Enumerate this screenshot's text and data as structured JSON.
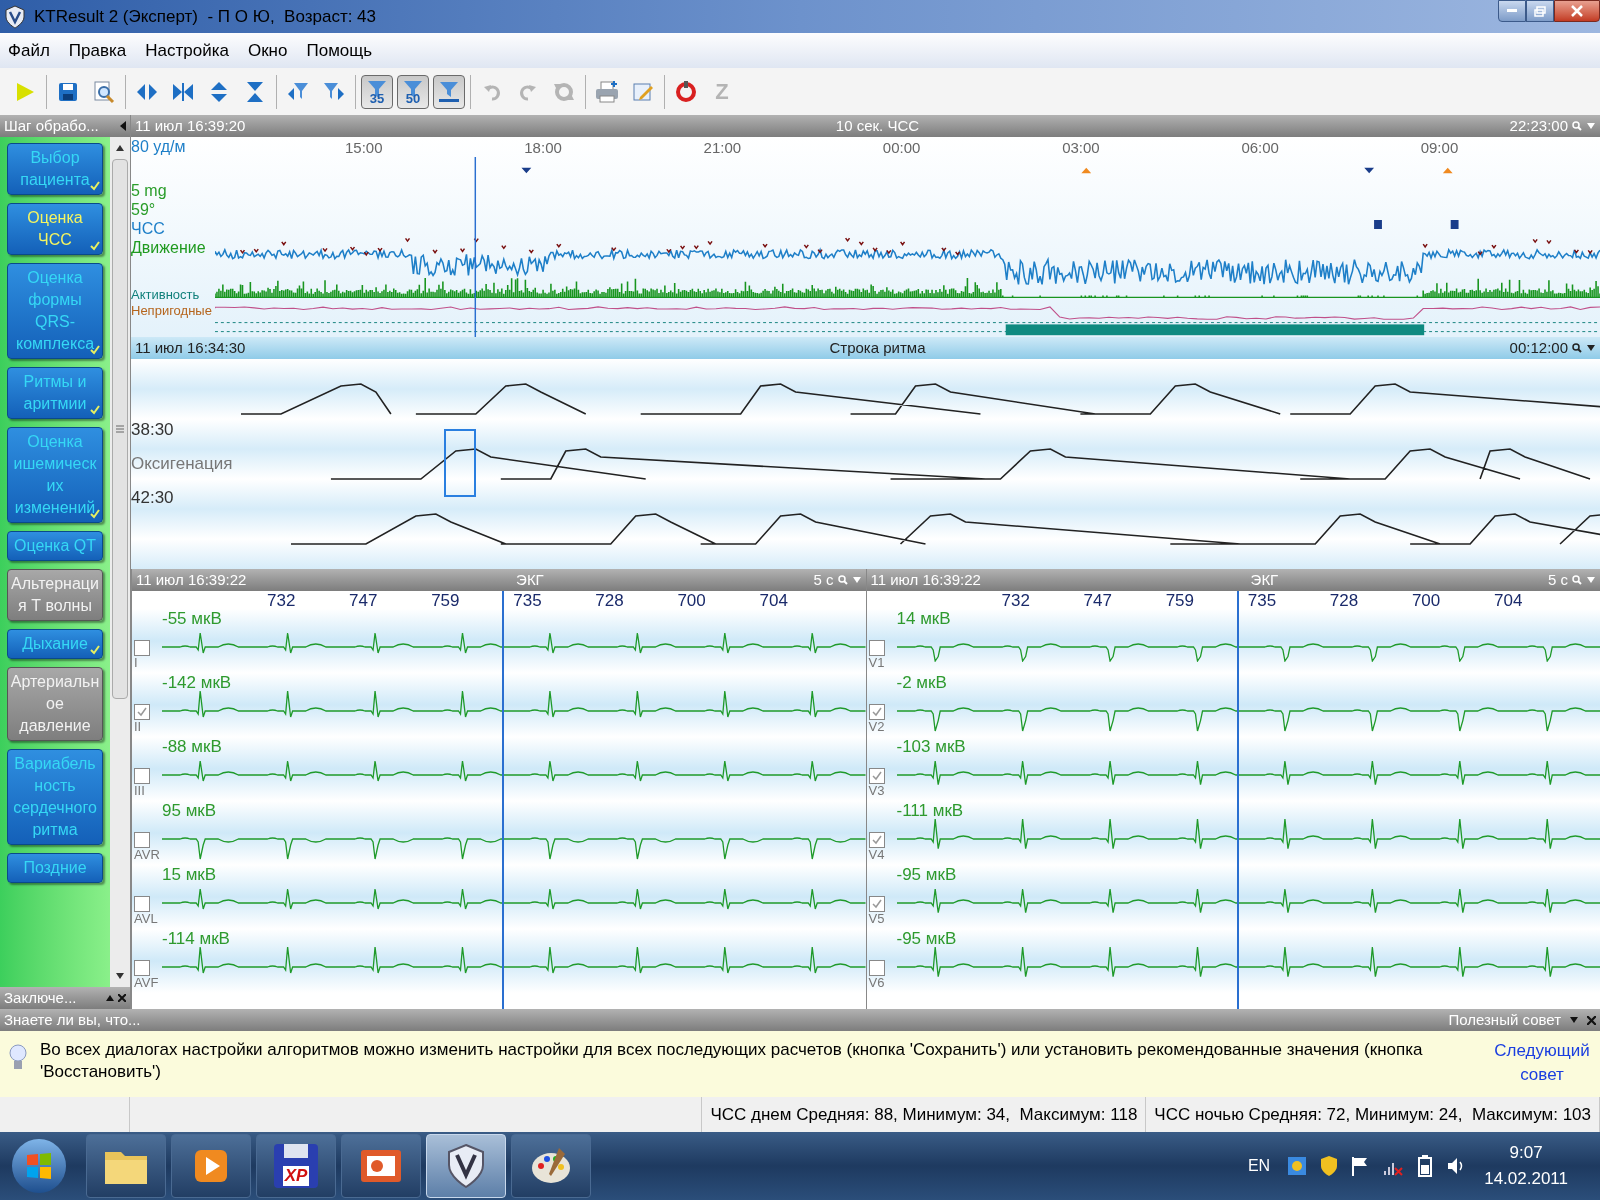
{
  "window": {
    "title": "KTResult 2 (Эксперт)  - П О Ю,  Возраст: 43"
  },
  "menu": [
    "Файл",
    "Правка",
    "Настройка",
    "Окно",
    "Помощь"
  ],
  "toolbar": [
    [
      {
        "kind": "play",
        "pressed": false,
        "disabled": false
      }
    ],
    [
      {
        "kind": "save",
        "pressed": false,
        "disabled": false
      },
      {
        "kind": "preview",
        "pressed": false,
        "disabled": false
      }
    ],
    [
      {
        "kind": "expand-h",
        "pressed": false,
        "disabled": false
      },
      {
        "kind": "collapse-h",
        "pressed": false,
        "disabled": false
      },
      {
        "kind": "expand-v",
        "pressed": false,
        "disabled": false
      },
      {
        "kind": "collapse-v",
        "pressed": false,
        "disabled": false
      }
    ],
    [
      {
        "kind": "filter-left",
        "pressed": false,
        "disabled": false
      },
      {
        "kind": "filter-right",
        "pressed": false,
        "disabled": false
      }
    ],
    [
      {
        "kind": "filter",
        "label": "35",
        "pressed": true,
        "disabled": false
      },
      {
        "kind": "filter",
        "label": "50",
        "pressed": true,
        "disabled": false
      },
      {
        "kind": "filter-line",
        "pressed": true,
        "disabled": false
      }
    ],
    [
      {
        "kind": "undo",
        "pressed": false,
        "disabled": true
      },
      {
        "kind": "redo",
        "pressed": false,
        "disabled": true
      },
      {
        "kind": "reset",
        "pressed": false,
        "disabled": true
      }
    ],
    [
      {
        "kind": "print",
        "pressed": false,
        "disabled": false
      },
      {
        "kind": "edit",
        "pressed": false,
        "disabled": false
      }
    ],
    [
      {
        "kind": "record",
        "pressed": false,
        "disabled": false
      },
      {
        "kind": "letter",
        "label": "Z",
        "pressed": false,
        "disabled": true
      }
    ]
  ],
  "sidebar": {
    "title": "Шаг обрабо...",
    "footer": "Заключе...",
    "items": [
      {
        "label": "Выбор пациента",
        "selected": false,
        "done": true,
        "disabled": false
      },
      {
        "label": "Оценка ЧСС",
        "selected": true,
        "done": true,
        "disabled": false
      },
      {
        "label": "Оценка формы QRS-комплекса",
        "selected": false,
        "done": true,
        "disabled": false
      },
      {
        "label": "Ритмы и аритмии",
        "selected": false,
        "done": true,
        "disabled": false
      },
      {
        "label": "Оценка ишемических изменений",
        "selected": false,
        "done": true,
        "disabled": false
      },
      {
        "label": "Оценка QT",
        "selected": false,
        "done": false,
        "disabled": false
      },
      {
        "label": "Альтернация Т волны",
        "selected": false,
        "done": false,
        "disabled": true
      },
      {
        "label": "Дыхание",
        "selected": false,
        "done": true,
        "disabled": false
      },
      {
        "label": "Артериальное давление",
        "selected": false,
        "done": false,
        "disabled": true
      },
      {
        "label": "Вариабельность сердечного ритма",
        "selected": false,
        "done": false,
        "disabled": false
      },
      {
        "label": "Поздние",
        "selected": false,
        "done": false,
        "disabled": false
      }
    ]
  },
  "trend_panel": {
    "date": "11 июл 16:39:20",
    "title": "10 сек. ЧСС",
    "time": "22:23:00",
    "scale": "80 уд/м",
    "labels": [
      {
        "text": "5 mg",
        "kind": "channel",
        "color": "#2a9d2a"
      },
      {
        "text": "59°",
        "kind": "channel",
        "color": "#2a9d2a"
      },
      {
        "text": "ЧСС",
        "kind": "channel",
        "color": "#1e7fc8"
      },
      {
        "text": "Движение",
        "kind": "channel",
        "color": "#1f9a1f"
      },
      {
        "text": "Активность",
        "kind": "track",
        "color": "#0f7f7a"
      },
      {
        "text": "Непригодные",
        "kind": "track",
        "color": "#b5651d"
      }
    ],
    "ticks": [
      "15:00",
      "18:00",
      "21:00",
      "00:00",
      "03:00",
      "06:00",
      "09:00"
    ]
  },
  "rhythm_panel": {
    "date": "11 июл 16:34:30",
    "title": "Строка ритма",
    "time": "00:12:00",
    "labels": [
      "38:30",
      "Оксигенация",
      "42:30"
    ]
  },
  "ecg_panels": [
    {
      "date": "11 июл 16:39:22",
      "title": "ЭКГ",
      "scale": "5 с",
      "intervals": [
        "732",
        "747",
        "759",
        "735",
        "728",
        "700",
        "704"
      ],
      "leads": [
        {
          "name": "I",
          "amplitude": "-55 мкВ",
          "checked": false
        },
        {
          "name": "II",
          "amplitude": "-142 мкВ",
          "checked": true
        },
        {
          "name": "III",
          "amplitude": "-88 мкВ",
          "checked": false
        },
        {
          "name": "AVR",
          "amplitude": "95 мкВ",
          "checked": false
        },
        {
          "name": "AVL",
          "amplitude": "15 мкВ",
          "checked": false
        },
        {
          "name": "AVF",
          "amplitude": "-114 мкВ",
          "checked": false
        }
      ]
    },
    {
      "date": "11 июл 16:39:22",
      "title": "ЭКГ",
      "scale": "5 с",
      "intervals": [
        "732",
        "747",
        "759",
        "735",
        "728",
        "700",
        "704"
      ],
      "leads": [
        {
          "name": "V1",
          "amplitude": "14 мкВ",
          "checked": false
        },
        {
          "name": "V2",
          "amplitude": "-2 мкВ",
          "checked": true
        },
        {
          "name": "V3",
          "amplitude": "-103 мкВ",
          "checked": true
        },
        {
          "name": "V4",
          "amplitude": "-111 мкВ",
          "checked": true
        },
        {
          "name": "V5",
          "amplitude": "-95 мкВ",
          "checked": true
        },
        {
          "name": "V6",
          "amplitude": "-95 мкВ",
          "checked": false
        }
      ]
    }
  ],
  "tip": {
    "header": "Знаете ли вы, что...",
    "title": "Полезный совет",
    "text": "Во всех диалогах настройки алгоритмов можно изменить настройки для всех последующих расчетов (кнопка 'Сохранить') или установить рекомендованные значения (кнопка 'Восстановить')",
    "link": "Следующий совет"
  },
  "status_bar": [
    "ЧСС днем Средняя: 88, Минимум: 34,  Максимум: 118",
    "ЧСС ночью Средняя: 72, Минимум: 24,  Максимум: 103"
  ],
  "taskbar": {
    "apps": [
      {
        "kind": "folder",
        "selected": false
      },
      {
        "kind": "player",
        "selected": false
      },
      {
        "kind": "floppy",
        "label": "XP",
        "selected": false
      },
      {
        "kind": "slides",
        "selected": false
      },
      {
        "kind": "shield",
        "selected": true
      },
      {
        "kind": "palette",
        "selected": false
      }
    ],
    "language": "EN",
    "time": "9:07",
    "date": "14.02.2011"
  }
}
